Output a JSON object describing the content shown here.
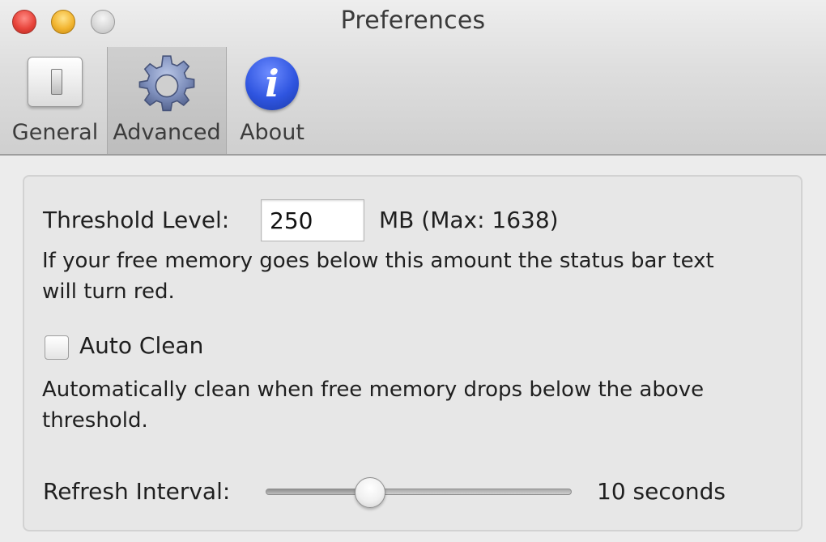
{
  "window": {
    "title": "Preferences"
  },
  "toolbar": {
    "tabs": [
      {
        "label": "General",
        "icon": "light-switch-icon"
      },
      {
        "label": "Advanced",
        "icon": "gear-icon",
        "selected": true
      },
      {
        "label": "About",
        "icon": "info-icon",
        "glyph": "i"
      }
    ]
  },
  "advanced": {
    "threshold_label": "Threshold Level:",
    "threshold_value": "250",
    "threshold_unit": "MB (Max: 1638)",
    "threshold_help_line1": "If your free memory goes below this amount the status bar text",
    "threshold_help_line2": "will turn red.",
    "auto_clean_label": "Auto Clean",
    "auto_clean_checked": false,
    "auto_clean_help_line1": "Automatically clean when free memory drops below the above",
    "auto_clean_help_line2": "threshold.",
    "refresh_label": "Refresh Interval:",
    "refresh_value_text": "10 seconds",
    "refresh_slider_fraction": 0.34
  },
  "colors": {
    "close": "#e8453c",
    "minimize": "#f2b530",
    "zoom": "#d6d6d6",
    "info_icon": "#2f55e0"
  }
}
